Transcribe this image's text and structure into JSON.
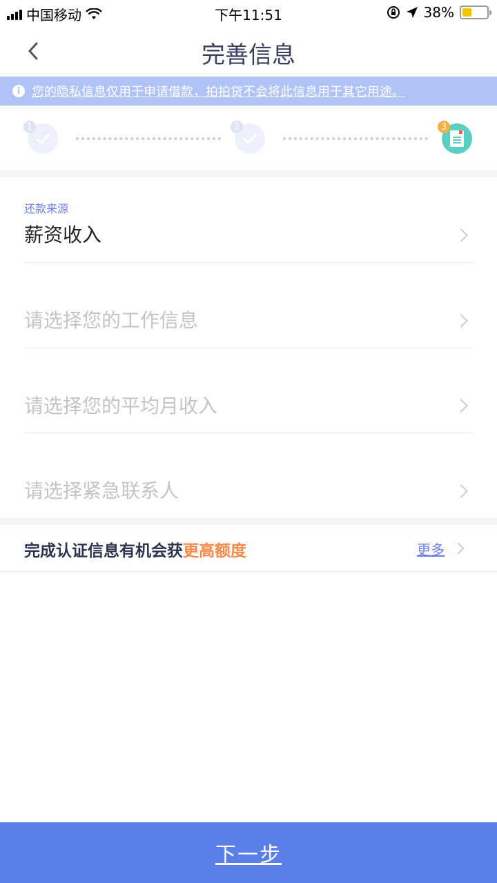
{
  "status_bar": {
    "carrier": "中国移动",
    "time": "下午11:51",
    "battery": "38%",
    "battery_level": 0.38
  },
  "nav": {
    "title": "完善信息"
  },
  "banner": {
    "icon": "info-icon",
    "text": "您的隐私信息仅用于申请借款，拍拍贷不会将此信息用于其它用途。"
  },
  "stepper": {
    "steps": [
      {
        "number": "1",
        "state": "done"
      },
      {
        "number": "2",
        "state": "done"
      },
      {
        "number": "3",
        "state": "current"
      }
    ]
  },
  "form": {
    "repayment_source_label": "还款来源",
    "repayment_source_value": "薪资收入",
    "job_info_placeholder": "请选择您的工作信息",
    "monthly_income_placeholder": "请选择您的平均月收入",
    "emergency_contact_placeholder": "请选择紧急联系人"
  },
  "promo": {
    "text": "完成认证信息有机会获",
    "highlight": "更高额度",
    "more": "更多"
  },
  "footer": {
    "next_label": "下一步"
  },
  "colors": {
    "accent": "#5b7fe9",
    "banner": "#afc3f8",
    "highlight": "#f58a4b",
    "label": "#6a7ee8"
  }
}
